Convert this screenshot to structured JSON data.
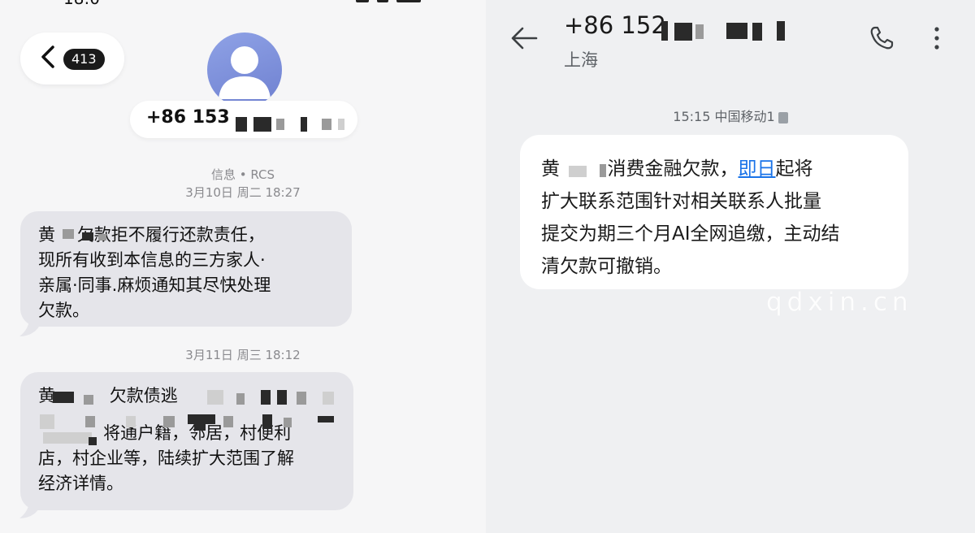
{
  "left": {
    "status_time": "18:0",
    "unread_count": "413",
    "contact_number": "+86 153",
    "thread_label": "信息 • RCS",
    "messages": [
      {
        "timestamp": "3月10日 周二 18:27",
        "text": "黄    欠款拒不履行还款责任，\n现所有收到本信息的三方家人·\n亲属·同事.麻烦通知其尽快处理\n欠款。"
      },
      {
        "timestamp": "3月11日 周三 18:12",
        "line1": "黄          欠款债逃",
        "text": "            将通户籍，邻居，村便利\n店，村企业等，陆续扩大范围了解\n经济详情。"
      }
    ]
  },
  "right": {
    "contact_number": "+86 152",
    "location": "上海",
    "timestamp": "15:15 中国移动1",
    "message": {
      "pre": "黄        消费金融欠款，",
      "link": "即日",
      "post": "起将\n扩大联系范围针对相关联系人批量\n提交为期三个月AI全网追缴，主动结\n清欠款可撤销。"
    },
    "watermark": "qdxin.cn"
  },
  "icons": {
    "back_chevron": "chevron-left-icon",
    "avatar": "person-icon",
    "back_arrow": "arrow-left-icon",
    "phone": "phone-icon",
    "more": "more-vertical-icon"
  }
}
